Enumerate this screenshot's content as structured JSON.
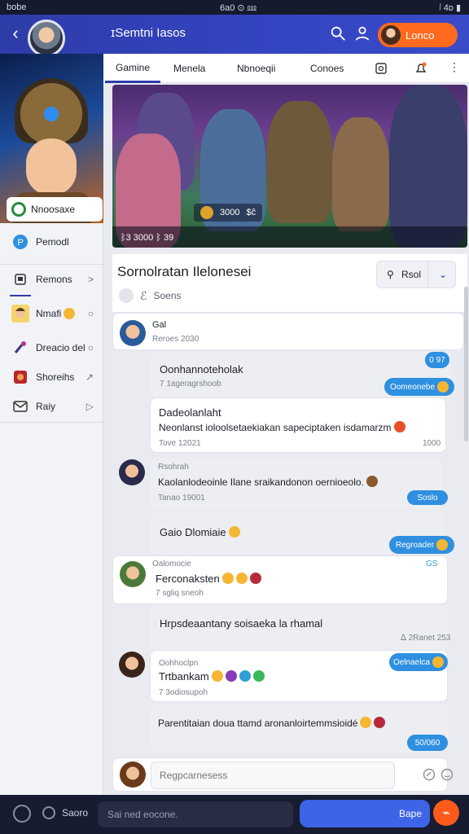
{
  "status": {
    "left": "bobe",
    "center": "6a0 ⊙ ⅏",
    "right": "ᶴ 4ᴅ ▮"
  },
  "appbar": {
    "title": "ɪSemtni Iasos",
    "user_label": "Lonco"
  },
  "sidebar": {
    "profile_name": "Nnoosaxe",
    "items": [
      {
        "label": "Pemodl",
        "icon": "circle-p-icon",
        "trail": ""
      },
      {
        "label": "Remons",
        "icon": "tablet-icon",
        "trail": ">"
      },
      {
        "label": "Nmafi",
        "icon": "avatar-icon",
        "trail": "○"
      },
      {
        "label": "Dreacio del",
        "icon": "brush-icon",
        "trail": "○"
      },
      {
        "label": "Shoreihs",
        "icon": "red-square-icon",
        "trail": "↗"
      },
      {
        "label": "Raiy",
        "icon": "mail-icon",
        "trail": "▷"
      }
    ]
  },
  "tabs": [
    {
      "label": "Gamine",
      "active": true
    },
    {
      "label": "Menela",
      "active": false
    },
    {
      "label": "Nbnoeqii",
      "active": false
    },
    {
      "label": "Conoes",
      "active": false
    }
  ],
  "banner": {
    "stats_value": "3000",
    "stats_extra": "$ĉ",
    "footer": "ᛒ3 3000 ᛒ 39"
  },
  "section": {
    "title": "Sornolratan Ilelonesei",
    "sub": "Soens",
    "button_label": "Rsol",
    "button_caret": "⌄"
  },
  "messages": {
    "m1": {
      "name": "Gal",
      "sub": "Reroes 2030"
    },
    "r1": {
      "text": "Oonhannoteholak",
      "sub": "7 1ageragrshoob",
      "chip_top": "0 97",
      "chip": "Oomeonebe"
    },
    "r2": {
      "text": "Dadeolanlaht",
      "text2": "Neonlanst ioloolsetaekiakan sapeciptaken isdamarzm",
      "sub": "Tove 12021",
      "num": "1000"
    },
    "m3": {
      "name": "Rsohrah",
      "text": "Kaolanlodeoinle Ilane sraikandonon oernioeolo.",
      "sub": "Tanao 19001",
      "chip": "Soslo"
    },
    "m4": {
      "text": "Gaio Dlomiaie"
    },
    "m4chip": "Regroader",
    "m5": {
      "name": "Oalomocie",
      "text": "Ferconaksten",
      "sub": "7 sgliq sneoh",
      "badge": "GS"
    },
    "m6": {
      "text": "Hrpsdeaantany soisaeka la rhamal",
      "sub": "ᐃ 2Ranet 253"
    },
    "m7": {
      "name": "Oohhoclpn",
      "text": "Trtbankam",
      "sub": "7 3odiosupoh",
      "chip": "Oelnaelca"
    },
    "m8": {
      "text": "Parentitaian doua ttamd aronanloirtemmsioidé",
      "chip": "50/060"
    },
    "composer": {
      "placeholder": "Regpcarnesess"
    }
  },
  "bottombar": {
    "label": "Saoro",
    "field": "Sai ned eocone.",
    "send": "Bape",
    "fab": "⌁"
  },
  "colors": {
    "accent": "#2e3ca8",
    "orange": "#ff6a1f",
    "chip_blue": "#2f8fe0"
  }
}
